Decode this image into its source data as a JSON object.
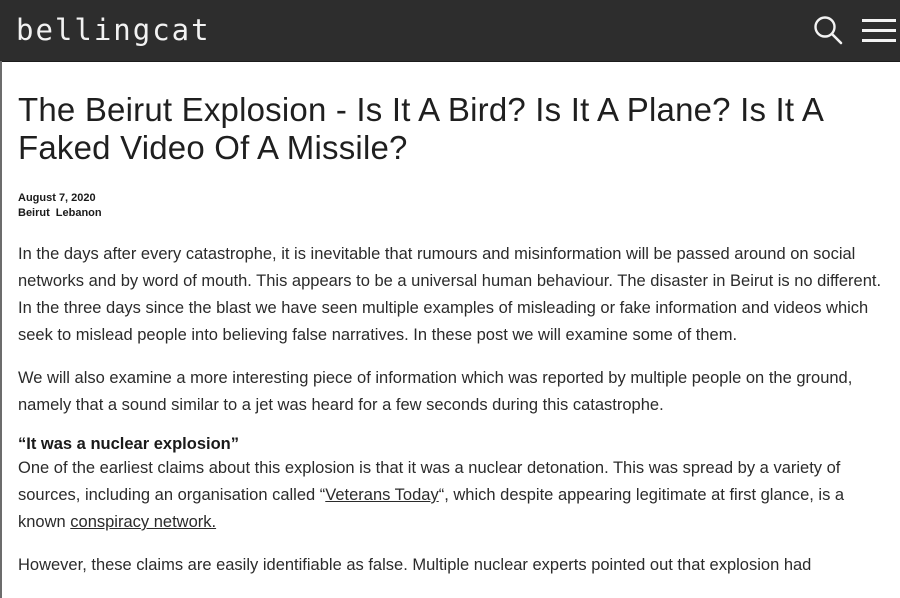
{
  "header": {
    "logo": "bellingcat",
    "search_icon": "search-icon",
    "menu_icon": "hamburger-menu-icon",
    "background": "#2d2d2d"
  },
  "article": {
    "title": "The Beirut Explosion - Is It A Bird? Is It A Plane? Is It A Faked Video Of A Missile?",
    "date": "August 7, 2020",
    "tags": [
      "Beirut",
      "Lebanon"
    ],
    "paragraphs": {
      "p1": "In the days after every catastrophe, it is inevitable that rumours and misinformation will be passed around on social networks and by word of mouth. This appears to be a universal human behaviour. The disaster in Beirut is no different. In the three days since the blast we have seen multiple examples of misleading or fake information and videos which seek to mislead people into believing false narratives. In these post we will examine some of them.",
      "p2": "We will also examine a more interesting piece of information which was reported by multiple people on the ground, namely that a sound similar to a jet was heard for a few seconds during this catastrophe.",
      "subhead": "“It was a nuclear explosion”",
      "p3_part1": "One of the earliest claims about this explosion is that it was a nuclear detonation. This was spread by a variety of sources, including an organisation called “",
      "p3_link1": "Veterans Today",
      "p3_part2": "“, which despite appearing legitimate at first glance, is a known ",
      "p3_link2": "conspiracy network.",
      "p4": "However, these claims are easily identifiable as false. Multiple nuclear experts pointed out that explosion had"
    }
  }
}
